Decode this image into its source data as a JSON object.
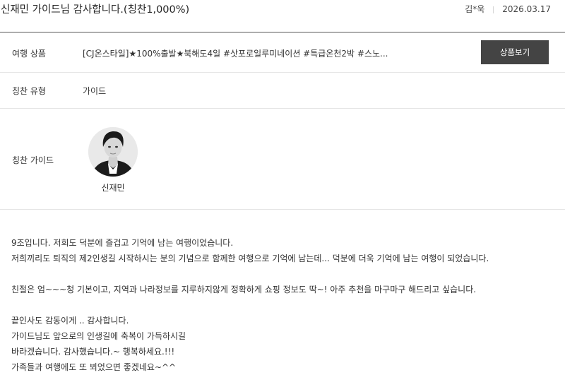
{
  "header": {
    "title": "신재민 가이드님 감사합니다.(칭찬1,000%)",
    "author": "김*욱",
    "date": "2026.03.17"
  },
  "rows": {
    "product": {
      "label": "여행 상품",
      "value": "[CJ온스타일]★100%출발★북해도4일 #삿포로일루미네이션 #특급온천2박 #스노...",
      "button": "상품보기"
    },
    "type": {
      "label": "칭찬 유형",
      "value": "가이드"
    },
    "guide": {
      "label": "칭찬 가이드",
      "name": "신재민"
    }
  },
  "body": {
    "p1": "9조입니다. 저희도 덕분에 즐겁고 기억에 남는 여행이었습니다.",
    "p2": "저희끼리도 퇴직의 제2인생길 시작하시는 분의 기념으로 함께한 여행으로 기억에 남는데... 덕분에 더욱 기억에 남는 여행이 되었습니다.",
    "p3": "친절은 엄~~~청 기본이고, 지역과 나라정보를 지루하지않게 정확하게 쇼핑 정보도 딱~! 아주 추천을 마구마구 해드리고 싶습니다.",
    "p4": "끝인사도 감동이게 .. 감사합니다.",
    "p5": "가이드님도 앞으로의 인생길에 축복이 가득하시길",
    "p6": "바라겠습니다. 감사했습니다.~ 행복하세요.!!!",
    "p7": "가족들과 여행에도 또 뵈었으면 좋겠네요~^^"
  },
  "icons": {
    "avatar": "guide-avatar-photo"
  }
}
